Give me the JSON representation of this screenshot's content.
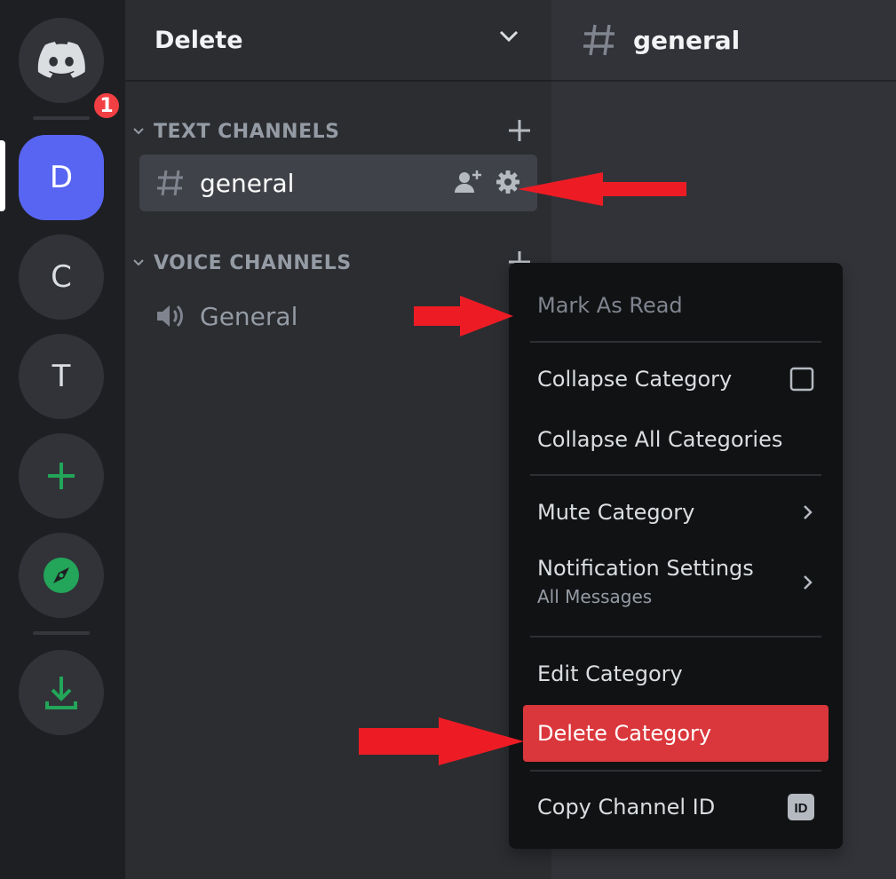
{
  "guild_bar": {
    "home_icon": "discord-logo-icon",
    "home_badge": "1",
    "servers": [
      {
        "letter": "D"
      },
      {
        "letter": "C"
      },
      {
        "letter": "T"
      }
    ],
    "add_server_icon": "plus-icon",
    "discover_icon": "compass-icon",
    "download_icon": "download-icon"
  },
  "server": {
    "name": "Delete"
  },
  "categories": {
    "text": {
      "label": "TEXT CHANNELS",
      "channels": [
        {
          "name": "general"
        }
      ]
    },
    "voice": {
      "label": "VOICE CHANNELS",
      "channels": [
        {
          "name": "General"
        }
      ]
    }
  },
  "topbar": {
    "channel_name": "general"
  },
  "context_menu": {
    "mark_as_read": "Mark As Read",
    "collapse_category": "Collapse Category",
    "collapse_all": "Collapse All Categories",
    "mute_category": "Mute Category",
    "notification_settings": "Notification Settings",
    "notification_value": "All Messages",
    "edit_category": "Edit Category",
    "delete_category": "Delete Category",
    "copy_channel_id": "Copy Channel ID",
    "id_badge": "ID"
  },
  "colors": {
    "accent": "#5865f2",
    "danger": "#da373c",
    "green": "#23a55a",
    "annotation_arrow": "#ed1c24"
  }
}
